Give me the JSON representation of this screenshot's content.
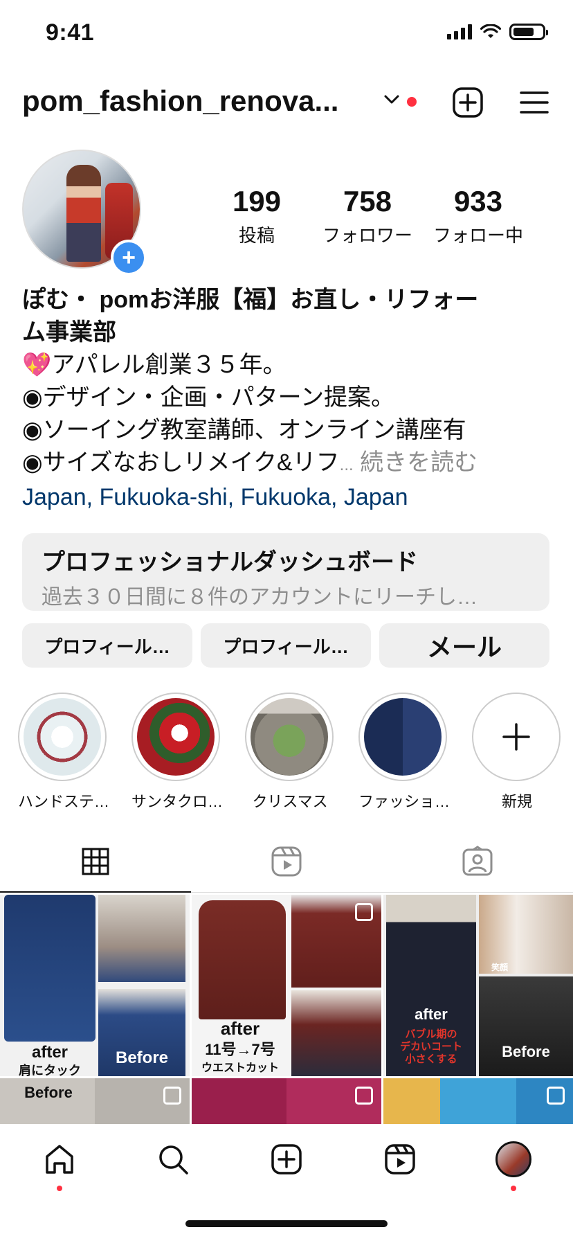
{
  "status_bar": {
    "time": "9:41"
  },
  "header": {
    "username": "pom_fashion_renova...",
    "icons": [
      "chevron-down-icon",
      "new-post-icon",
      "menu-icon"
    ]
  },
  "profile": {
    "stats": [
      {
        "value": "199",
        "label": "投稿"
      },
      {
        "value": "758",
        "label": "フォロワー"
      },
      {
        "value": "933",
        "label": "フォロー中"
      }
    ],
    "bio": {
      "name_line1": "ぽむ・ pomお洋服【福】お直し・リフォー",
      "name_line2": "ム事業部",
      "line1": "💖アパレル創業３５年。",
      "line2": "◉デザイン・企画・パターン提案。",
      "line3": "◉ソーイング教室講師、オンライン講座有",
      "line4": "◉サイズなおしリメイク&リフ",
      "ellipsis": "...",
      "more": "続きを読む",
      "location": "Japan, Fukuoka-shi, Fukuoka, Japan"
    }
  },
  "dashboard": {
    "title": "プロフェッショナルダッシュボード",
    "subtitle": "過去３０日間に８件のアカウントにリーチし…"
  },
  "buttons": [
    "プロフィール…",
    "プロフィール…",
    "メール"
  ],
  "highlights": [
    {
      "label": "ハンドステ…"
    },
    {
      "label": "サンタクロ…"
    },
    {
      "label": "クリスマス"
    },
    {
      "label": "ファッショ…"
    },
    {
      "label": "新規"
    }
  ],
  "grid": {
    "post1": {
      "after": "after",
      "caption": "肩にタック",
      "before": "Before"
    },
    "post2": {
      "after": "after",
      "caption": "11号→7号",
      "caption2": "ウエストカット"
    },
    "post3": {
      "after": "after",
      "caption": "バブル期の",
      "caption2": "デカいコート",
      "caption3": "小さくする",
      "before": "Before",
      "smile": "笑顔"
    },
    "post4": {
      "before": "Before"
    }
  },
  "colors": {
    "accent": "#3b8ff0",
    "notify": "#ff3040",
    "link": "#00376b",
    "muted": "#8e8e8e"
  }
}
